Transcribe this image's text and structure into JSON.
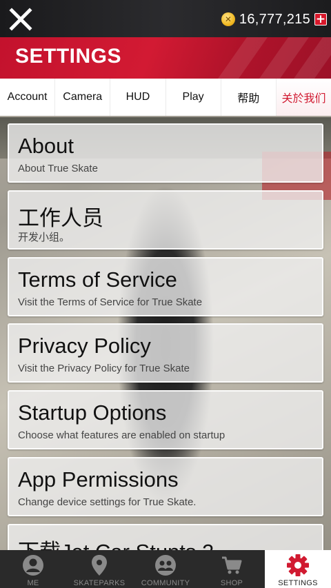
{
  "header": {
    "close_icon": "close-x-icon",
    "coin_icon": "coin-icon",
    "coin_count": "16,777,215",
    "add_coins_label": "+"
  },
  "title": "SETTINGS",
  "tabs": [
    {
      "label": "Account",
      "active": false
    },
    {
      "label": "Camera",
      "active": false
    },
    {
      "label": "HUD",
      "active": false
    },
    {
      "label": "Play",
      "active": false
    },
    {
      "label": "帮助",
      "active": false
    },
    {
      "label": "关於我们",
      "active": true
    }
  ],
  "items": [
    {
      "title": "About",
      "subtitle": "About True Skate"
    },
    {
      "title": "工作人员",
      "subtitle": "开发小组。"
    },
    {
      "title": "Terms of Service",
      "subtitle": "Visit the Terms of Service for True Skate"
    },
    {
      "title": "Privacy Policy",
      "subtitle": "Visit the Privacy Policy for True Skate"
    },
    {
      "title": "Startup Options",
      "subtitle": "Choose what features are enabled on startup"
    },
    {
      "title": "App Permissions",
      "subtitle": "Change device settings for True Skate."
    },
    {
      "title": "下载Jet Car Stunts 2",
      "subtitle": ""
    }
  ],
  "bottom_nav": [
    {
      "label": "ME",
      "icon": "person-icon",
      "active": false
    },
    {
      "label": "SKATEPARKS",
      "icon": "map-pin-icon",
      "active": false
    },
    {
      "label": "COMMUNITY",
      "icon": "community-icon",
      "active": false
    },
    {
      "label": "SHOP",
      "icon": "cart-icon",
      "active": false
    },
    {
      "label": "SETTINGS",
      "icon": "gear-icon",
      "active": true
    }
  ],
  "colors": {
    "accent_red": "#d11a31",
    "topbar": "#1f1f21",
    "nav_bg": "#2a2a2a"
  }
}
